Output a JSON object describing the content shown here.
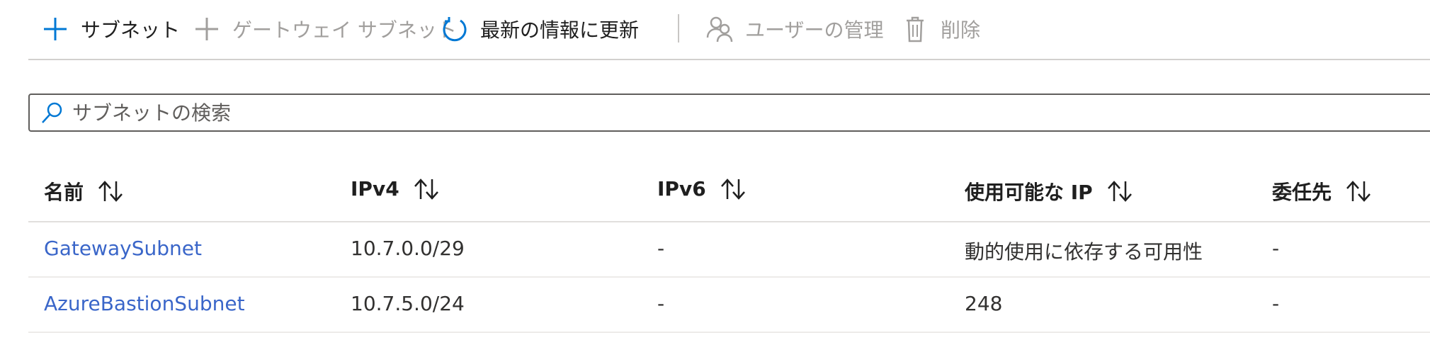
{
  "toolbar": {
    "add_subnet": "サブネット",
    "gateway_subnet": "ゲートウェイ サブネット",
    "refresh": "最新の情報に更新",
    "manage_users": "ユーザーの管理",
    "delete": "削除"
  },
  "search": {
    "placeholder": "サブネットの検索",
    "value": ""
  },
  "table": {
    "columns": [
      "名前",
      "IPv4",
      "IPv6",
      "使用可能な IP",
      "委任先"
    ],
    "rows": [
      {
        "name": "GatewaySubnet",
        "ipv4": "10.7.0.0/29",
        "ipv6": "-",
        "available_ips": "動的使用に依存する可用性",
        "delegated_to": "-"
      },
      {
        "name": "AzureBastionSubnet",
        "ipv4": "10.7.5.0/24",
        "ipv6": "-",
        "available_ips": "248",
        "delegated_to": "-"
      }
    ]
  },
  "colors": {
    "accent": "#0078d4",
    "link": "#3a66c9",
    "disabled": "#a19f9d"
  },
  "icons": {
    "add": "plus-icon",
    "gateway": "plus-icon",
    "refresh": "refresh-icon",
    "users": "people-icon",
    "delete": "trash-icon",
    "search": "search-icon",
    "sort": "sort-icon"
  }
}
